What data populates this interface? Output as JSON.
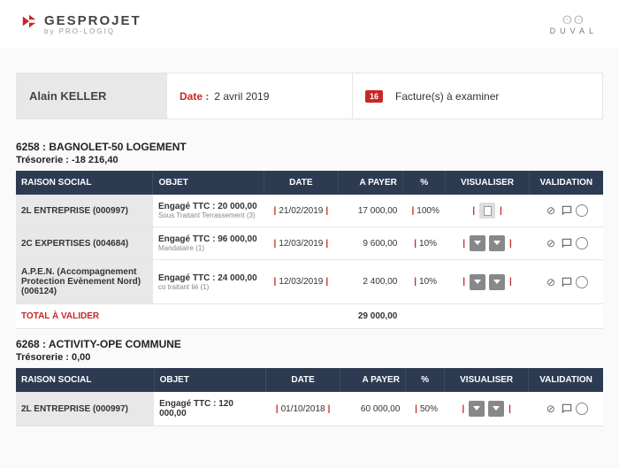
{
  "brand": {
    "name": "GESPROJET",
    "byline": "by PRO-LOGIQ"
  },
  "partner": {
    "name": "DUVAL"
  },
  "info": {
    "user": "Alain KELLER",
    "date_label": "Date :",
    "date_value": "2 avril 2019",
    "count": "16",
    "factures_label": "Facture(s) à examiner"
  },
  "columns": {
    "raison": "RAISON SOCIAL",
    "objet": "OBJET",
    "date": "DATE",
    "apayer": "A PAYER",
    "pct": "%",
    "visualiser": "VISUALISER",
    "validation": "VALIDATION"
  },
  "total_label": "TOTAL À VALIDER",
  "projects": [
    {
      "title": "6258 : BAGNOLET-50 LOGEMENT",
      "treso": "Trésorerie : -18 216,40",
      "rows": [
        {
          "raison": "2L ENTREPRISE (000997)",
          "objet_main": "Engagé TTC : 20 000,00",
          "objet_sub": "Sous Traitant Terrassement (3)",
          "date": "21/02/2019",
          "apayer": "17 000,00",
          "pct": "100%",
          "vis_variant": "light"
        },
        {
          "raison": "2C EXPERTISES (004684)",
          "objet_main": "Engagé TTC : 96 000,00",
          "objet_sub": "Mandataire (1)",
          "date": "12/03/2019",
          "apayer": "9 600,00",
          "pct": "10%",
          "vis_variant": "dark"
        },
        {
          "raison": "A.P.E.N. (Accompagnement Protection Evènement Nord) (006124)",
          "objet_main": "Engagé TTC : 24 000,00",
          "objet_sub": "co traitant lié (1)",
          "date": "12/03/2019",
          "apayer": "2 400,00",
          "pct": "10%",
          "vis_variant": "dark"
        }
      ],
      "total": "29 000,00"
    },
    {
      "title": "6268 : ACTIVITY-OPE COMMUNE",
      "treso": "Trésorerie : 0,00",
      "rows": [
        {
          "raison": "2L ENTREPRISE (000997)",
          "objet_main": "Engagé TTC : 120 000,00",
          "objet_sub": "",
          "date": "01/10/2018",
          "apayer": "60 000,00",
          "pct": "50%",
          "vis_variant": "dark"
        }
      ],
      "total": ""
    }
  ]
}
